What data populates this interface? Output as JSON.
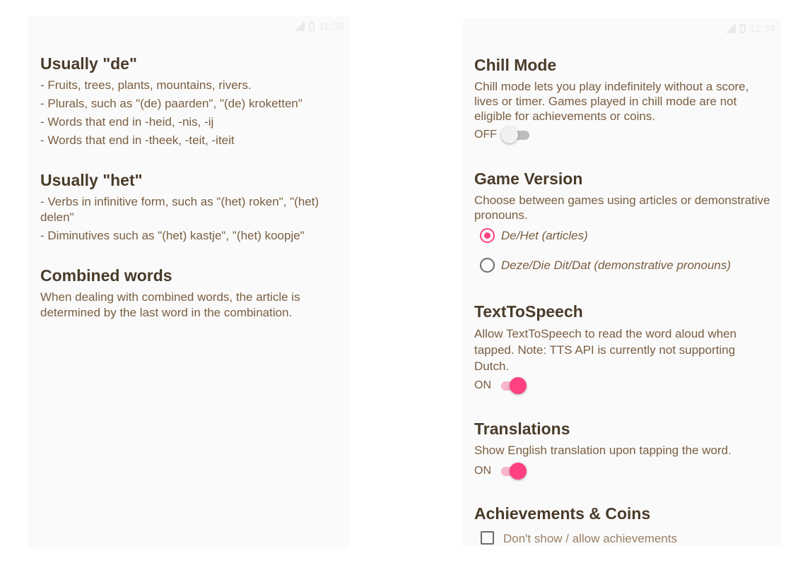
{
  "left_screen": {
    "status_time": "11:35",
    "sections": [
      {
        "title": "Usually \"de\"",
        "lines": [
          "- Fruits, trees, plants, mountains, rivers.",
          "- Plurals, such as \"(de) paarden\", \"(de) kroketten\"",
          "- Words that end in -heid, -nis, -ij",
          "- Words that end in -theek, -teit, -iteit"
        ]
      },
      {
        "title": "Usually \"het\"",
        "lines": [
          "- Verbs in infinitive form, such as \"(het) roken\", \"(het) delen\"",
          "- Diminutives such as \"(het) kastje\", \"(het) koopje\""
        ]
      },
      {
        "title": "Combined words",
        "lines": [
          "When dealing with combined words, the article is determined by the last word in the combination."
        ]
      }
    ]
  },
  "right_screen": {
    "status_time": "11:34",
    "chill_mode": {
      "title": "Chill Mode",
      "description": "Chill mode lets you play indefinitely without a score, lives or timer. Games played in chill mode are not eligible for achievements or coins.",
      "toggle_label": "OFF",
      "toggle_on": false
    },
    "game_version": {
      "title": "Game Version",
      "description": "Choose between games using articles or demonstrative pronouns.",
      "options": [
        {
          "label": "De/Het (articles)",
          "selected": true
        },
        {
          "label": "Deze/Die Dit/Dat (demonstrative pronouns)",
          "selected": false
        }
      ]
    },
    "text_to_speech": {
      "title": "TextToSpeech",
      "description": "Allow TextToSpeech to read the word aloud when tapped. Note: TTS API is currently not supporting Dutch.",
      "toggle_label": "ON",
      "toggle_on": true
    },
    "translations": {
      "title": "Translations",
      "description": "Show English translation upon tapping the word.",
      "toggle_label": "ON",
      "toggle_on": true
    },
    "achievements": {
      "title": "Achievements & Coins",
      "partial_text": "Don't show / allow achievements"
    }
  },
  "colors": {
    "accent": "#ff4081",
    "heading": "#4a3b2a",
    "body_text": "#7a5e41",
    "panel_bg": "#fafafa"
  }
}
